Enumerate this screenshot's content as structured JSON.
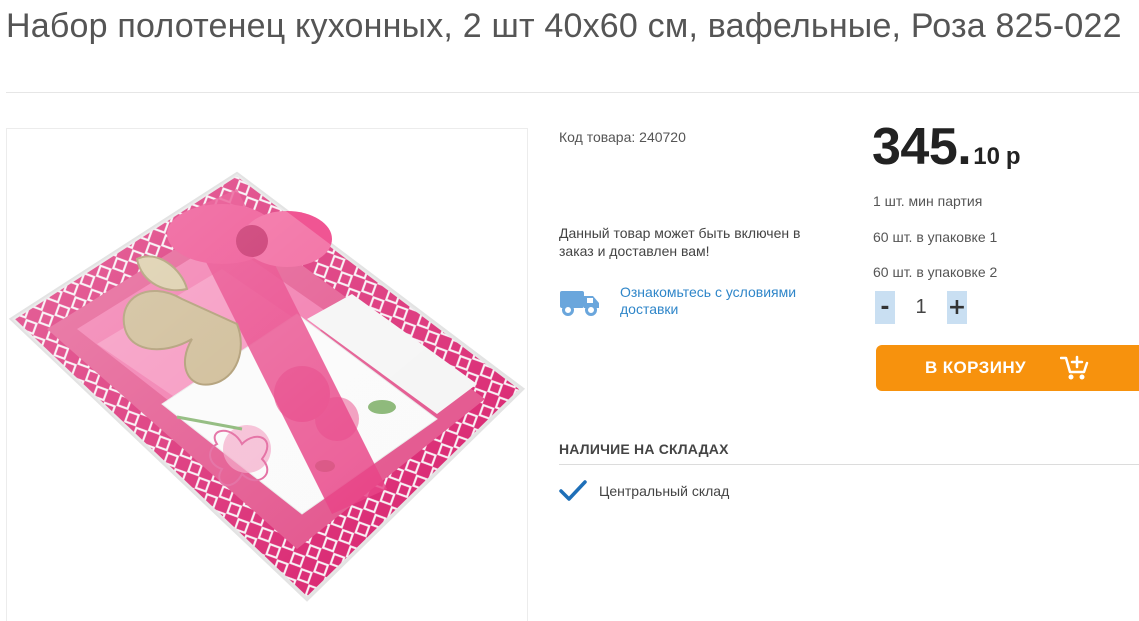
{
  "product": {
    "title": "Набор полотенец кухонных, 2 шт 40х60 см, вафельные, Роза 825-022",
    "sku_label": "Код товара: 240720",
    "availability_note": "Данный товар может быть включен в заказ и доставлен вам!",
    "delivery_link": "Ознакомьтесь с условиями доставки"
  },
  "price": {
    "main": "345.",
    "fraction": "10",
    "currency": "р"
  },
  "packaging": {
    "min_batch": "1 шт. мин партия",
    "pack1": "60 шт. в упаковке 1",
    "pack2": "60 шт. в упаковке 2"
  },
  "quantity": {
    "minus": "-",
    "value": "1",
    "plus": "+"
  },
  "cart": {
    "label": "В КОРЗИНУ"
  },
  "stock": {
    "title": "НАЛИЧИЕ НА СКЛАДАХ",
    "warehouses": [
      {
        "name": "Центральный склад",
        "available": true
      }
    ]
  },
  "colors": {
    "accent_orange": "#f7920d",
    "link_blue": "#2f86c9",
    "qty_button_blue": "#c9dff2",
    "check_blue": "#1e6fb8"
  },
  "icons": {
    "delivery": "truck-icon",
    "cart": "cart-add-icon",
    "stock": "check-icon"
  }
}
